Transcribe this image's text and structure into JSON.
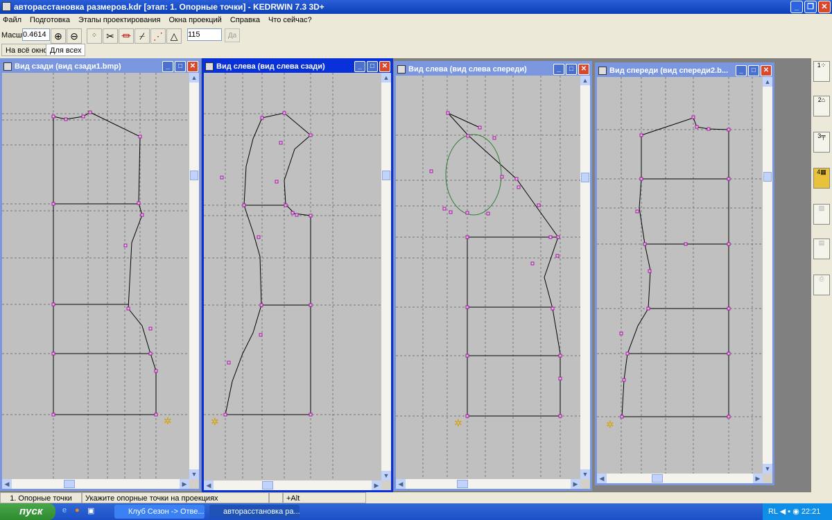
{
  "app": {
    "title": "авторасстановка размеров.kdr [этап: 1. Опорные точки] - KEDRWIN 7.3 3D+"
  },
  "menu": [
    "Файл",
    "Подготовка",
    "Этапы проектирования",
    "Окна проекций",
    "Справка",
    "Что сейчас?"
  ],
  "toolbar": {
    "scale_label": "Масшт",
    "scale_value": "0.4614",
    "number_value": "115",
    "ok_label": "Да",
    "tab_fit": "На всё окно",
    "tab_all": "Для всех"
  },
  "windows": [
    {
      "title": "Вид сзади (вид сзади1.bmp)"
    },
    {
      "title": "Вид слева (вид слева сзади)"
    },
    {
      "title": "Вид слева (вид слева спереди)"
    },
    {
      "title": "Вид спереди (вид спереди2.b..."
    }
  ],
  "status": {
    "stage": "1. Опорные точки",
    "hint": "Укажите опорные точки на проекциях",
    "keys": "+Alt"
  },
  "taskbar": {
    "start": "пуск",
    "tasks": [
      "Клуб Сезон -> Отве...",
      "авторасстановка ра..."
    ],
    "lang": "RL",
    "clock": "22:21"
  },
  "colors": {
    "outline": "#000000",
    "curve": "#2e7d32",
    "point": "#a020a0",
    "grid": "#5a5a5a"
  }
}
